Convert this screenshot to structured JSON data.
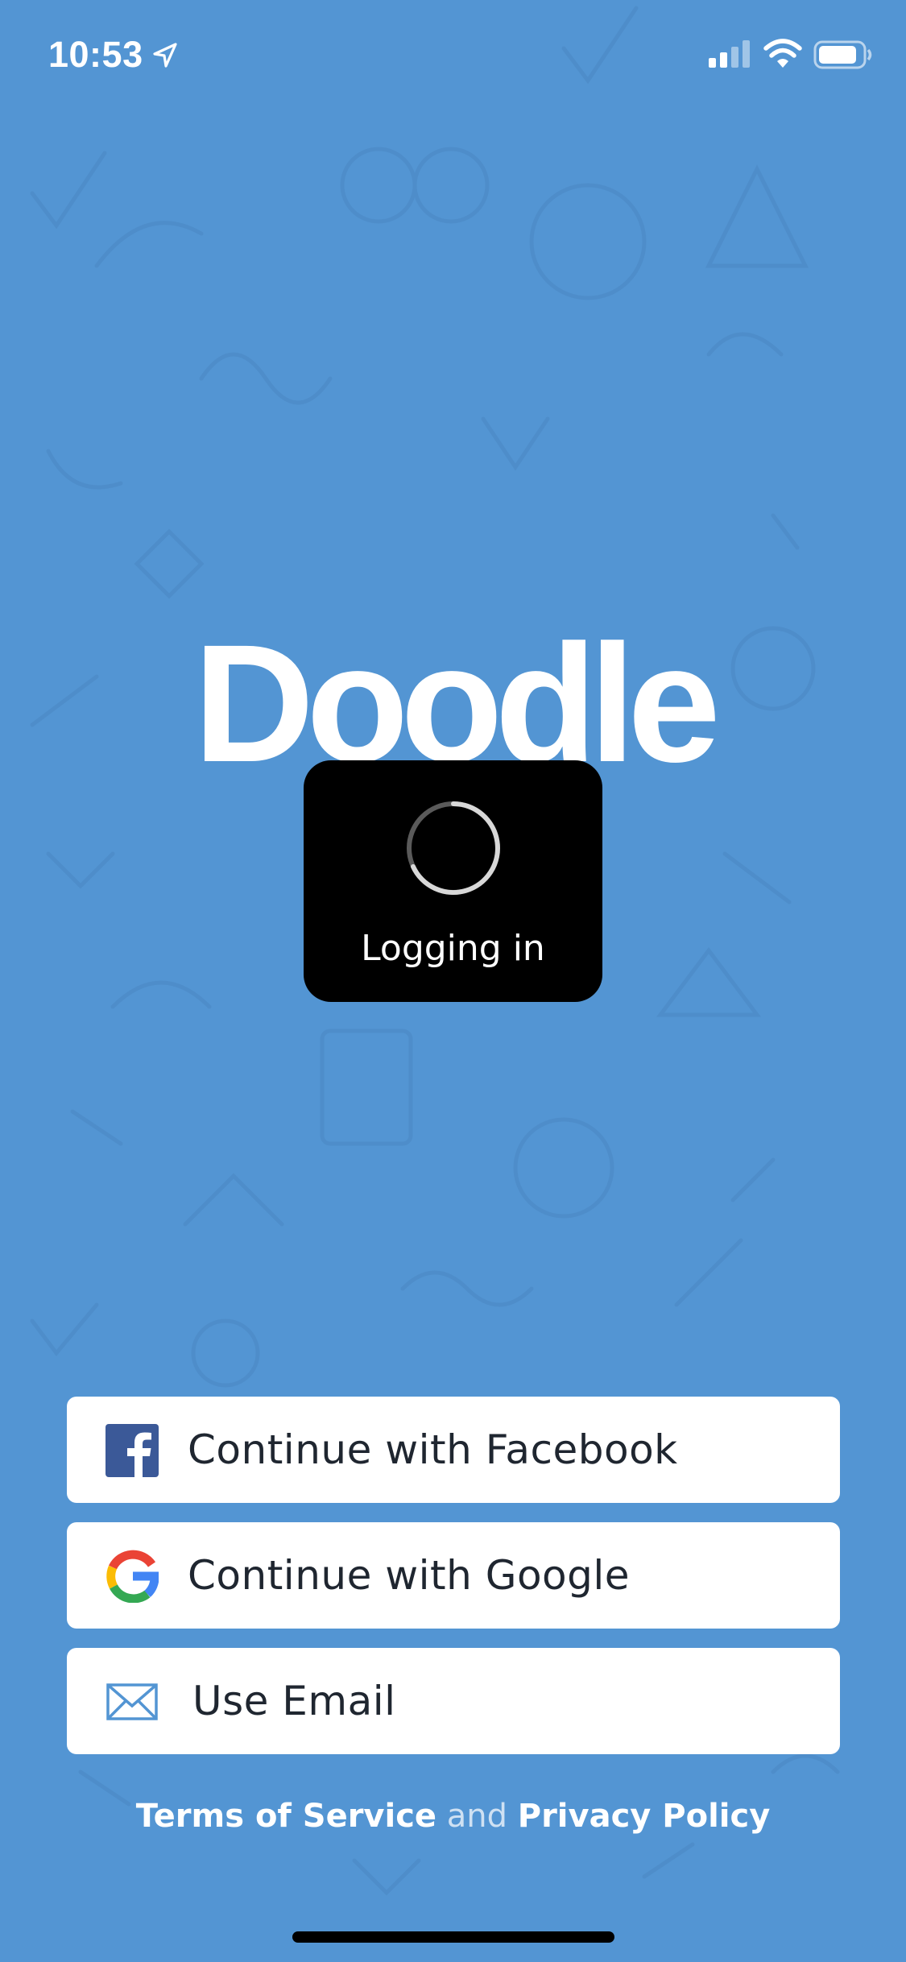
{
  "status_bar": {
    "time": "10:53",
    "icons": [
      "location-arrow-icon",
      "cellular-signal-icon",
      "wifi-icon",
      "battery-icon"
    ]
  },
  "logo": {
    "text": "Doodle"
  },
  "loading": {
    "text": "Logging in",
    "icon": "spinner-icon"
  },
  "buttons": {
    "facebook": {
      "label": "Continue with Facebook",
      "icon": "facebook-icon"
    },
    "google": {
      "label": "Continue with Google",
      "icon": "google-icon"
    },
    "email": {
      "label": "Use Email",
      "icon": "envelope-icon"
    }
  },
  "legal": {
    "terms": "Terms of Service",
    "and": "and",
    "privacy": "Privacy Policy"
  },
  "colors": {
    "background": "#5395d3",
    "facebook": "#3b5998",
    "hud": "#000000",
    "email_icon": "#5395d3"
  }
}
